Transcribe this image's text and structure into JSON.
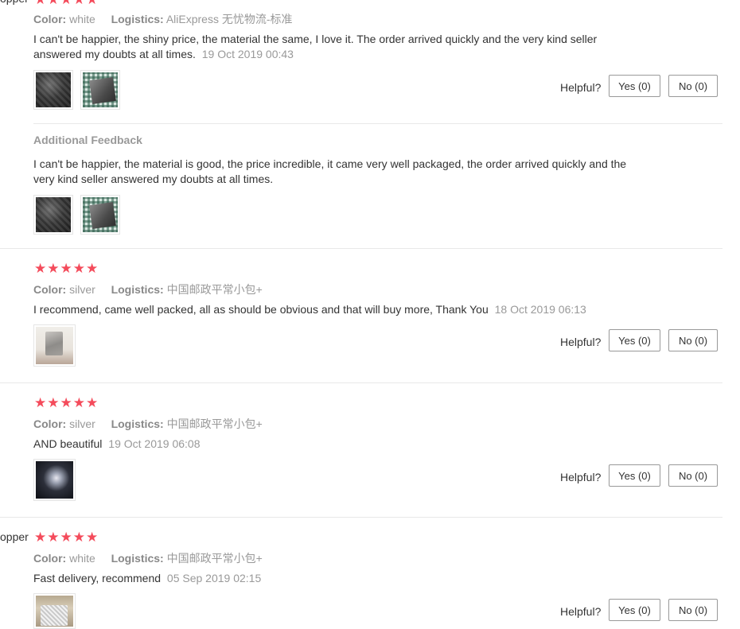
{
  "helpful_label": "Helpful?",
  "yes_label": "Yes (0)",
  "no_label": "No (0)",
  "color_key": "Color:",
  "logistics_key": "Logistics:",
  "additional_feedback_title": "Additional Feedback",
  "reviews": [
    {
      "user_name": "opper",
      "stars": "★★★★★",
      "color": "white",
      "logistics": "AliExpress 无忧物流-标准",
      "text": "I can't be happier, the shiny price, the material the same, I love it. The order arrived quickly and the very kind seller answered my doubts at all times.",
      "time": "19 Oct 2019 00:43",
      "additional_feedback": {
        "text": "I can't be happier, the material is good, the price incredible, it came very well packaged, the order arrived quickly and the very kind seller answered my doubts at all times."
      }
    },
    {
      "stars": "★★★★★",
      "color": "silver",
      "logistics": "中国邮政平常小包+",
      "text": "I recommend, came well packed, all as should be obvious and that will buy more, Thank You",
      "time": "18 Oct 2019 06:13"
    },
    {
      "stars": "★★★★★",
      "color": "silver",
      "logistics": "中国邮政平常小包+",
      "text": "AND beautiful",
      "time": "19 Oct 2019 06:08"
    },
    {
      "user_name": "opper",
      "stars": "★★★★★",
      "color": "white",
      "logistics": "中国邮政平常小包+",
      "text": "Fast delivery, recommend",
      "time": "05 Sep 2019 02:15"
    }
  ],
  "accent_star_color": "#f44b5b"
}
